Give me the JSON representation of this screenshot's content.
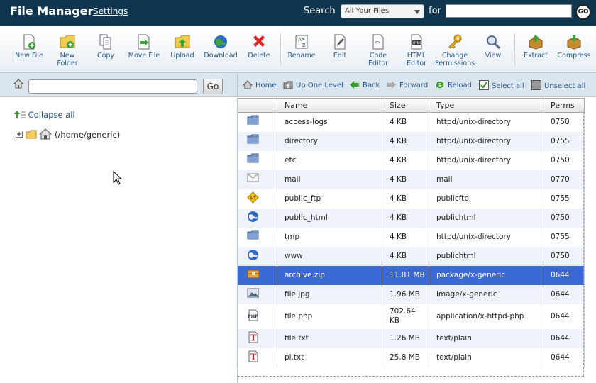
{
  "header": {
    "title": "File Manager",
    "settings_label": "Settings",
    "search_label": "Search",
    "search_scope": "All Your Files",
    "for_label": "for",
    "search_value": "",
    "go_label": "GO"
  },
  "toolbar": [
    {
      "label": "New File",
      "icon": "new-file-icon"
    },
    {
      "label": "New\nFolder",
      "icon": "new-folder-icon"
    },
    {
      "label": "Copy",
      "icon": "copy-icon"
    },
    {
      "label": "Move File",
      "icon": "move-file-icon"
    },
    {
      "label": "Upload",
      "icon": "upload-icon"
    },
    {
      "label": "Download",
      "icon": "download-icon"
    },
    {
      "label": "Delete",
      "icon": "delete-icon"
    },
    {
      "label": "Rename",
      "icon": "rename-icon"
    },
    {
      "label": "Edit",
      "icon": "edit-icon"
    },
    {
      "label": "Code\nEditor",
      "icon": "code-editor-icon"
    },
    {
      "label": "HTML\nEditor",
      "icon": "html-editor-icon"
    },
    {
      "label": "Change\nPermissions",
      "icon": "permissions-icon"
    },
    {
      "label": "View",
      "icon": "view-icon"
    },
    {
      "label": "Extract",
      "icon": "extract-icon"
    },
    {
      "label": "Compress",
      "icon": "compress-icon"
    }
  ],
  "pathbar": {
    "path_value": "",
    "go_label": "Go"
  },
  "nav": {
    "home": "Home",
    "up": "Up One Level",
    "back": "Back",
    "forward": "Forward",
    "reload": "Reload",
    "select_all": "Select all",
    "unselect_all": "Unselect all"
  },
  "tree": {
    "collapse_label": "Collapse all",
    "root_label": "(/home/generic)"
  },
  "table": {
    "columns": [
      "Name",
      "Size",
      "Type",
      "Perms"
    ],
    "rows": [
      {
        "icon": "folder-icon",
        "name": "access-logs",
        "size": "4 KB",
        "type": "httpd/unix-directory",
        "perms": "0750"
      },
      {
        "icon": "folder-icon",
        "name": "directory",
        "size": "4 KB",
        "type": "httpd/unix-directory",
        "perms": "0755"
      },
      {
        "icon": "folder-icon",
        "name": "etc",
        "size": "4 KB",
        "type": "httpd/unix-directory",
        "perms": "0750"
      },
      {
        "icon": "mail-icon",
        "name": "mail",
        "size": "4 KB",
        "type": "mail",
        "perms": "0770"
      },
      {
        "icon": "ftp-icon",
        "name": "public_ftp",
        "size": "4 KB",
        "type": "publicftp",
        "perms": "0755"
      },
      {
        "icon": "globe-icon",
        "name": "public_html",
        "size": "4 KB",
        "type": "publichtml",
        "perms": "0750"
      },
      {
        "icon": "folder-icon",
        "name": "tmp",
        "size": "4 KB",
        "type": "httpd/unix-directory",
        "perms": "0755"
      },
      {
        "icon": "globe-icon",
        "name": "www",
        "size": "4 KB",
        "type": "publichtml",
        "perms": "0750"
      },
      {
        "icon": "archive-icon",
        "name": "archive.zip",
        "size": "11.81 MB",
        "type": "package/x-generic",
        "perms": "0644",
        "selected": true
      },
      {
        "icon": "image-icon",
        "name": "file.jpg",
        "size": "1.96 MB",
        "type": "image/x-generic",
        "perms": "0644"
      },
      {
        "icon": "php-icon",
        "name": "file.php",
        "size": "702.64 KB",
        "type": "application/x-httpd-php",
        "perms": "0644"
      },
      {
        "icon": "text-icon",
        "name": "file.txt",
        "size": "1.26 MB",
        "type": "text/plain",
        "perms": "0644"
      },
      {
        "icon": "text-icon",
        "name": "pi.txt",
        "size": "25.8 MB",
        "type": "text/plain",
        "perms": "0644"
      }
    ]
  },
  "colors": {
    "header_bg": "#10364f",
    "selection": "#3c6ad4",
    "link": "#2a5a8c"
  }
}
